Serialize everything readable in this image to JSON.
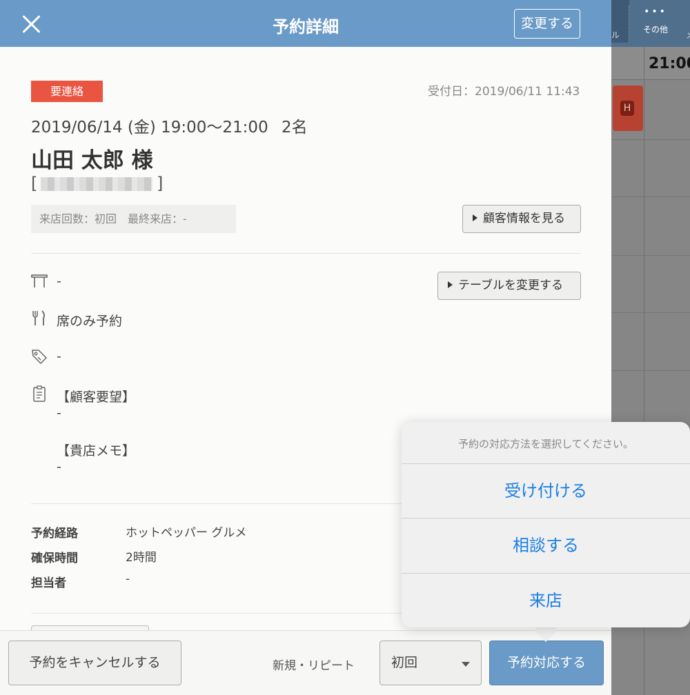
{
  "background": {
    "tab_partial_label": "ル",
    "more_dots": "•••",
    "more_label": "その他",
    "edge_label": "メ",
    "time_header": "21:00",
    "reservation_icon": "H"
  },
  "header": {
    "title": "予約詳細",
    "edit_label": "変更する"
  },
  "reservation": {
    "status_badge": "要連絡",
    "received_at": "受付日：2019/06/11 11:43",
    "datetime": "2019/06/14 (金) 19:00〜21:00",
    "party_size": "2名",
    "customer_name": "山田 太郎 様",
    "phone_open": "[",
    "phone_close": "]",
    "visit_history": "来店回数：初回　最終来店：-",
    "view_customer_label": "顧客情報を見る",
    "table_value": "-",
    "change_table_label": "テーブルを変更する",
    "course_value": "席のみ予約",
    "tag_value": "-",
    "request_heading": "【顧客要望】",
    "request_value": "-",
    "memo_heading": "【貴店メモ】",
    "memo_value": "-"
  },
  "details": [
    {
      "label": "予約経路",
      "value": "ホットペッパー グルメ"
    },
    {
      "label": "確保時間",
      "value": "2時間"
    },
    {
      "label": "担当者",
      "value": "-"
    }
  ],
  "footer": {
    "cancel_label": "予約をキャンセルする",
    "repeat_label": "新規・リピート",
    "visit_type_selected": "初回",
    "respond_label": "予約対応する"
  },
  "popover": {
    "prompt": "予約の対応方法を選択してください。",
    "options": [
      "受け付ける",
      "相談する",
      "来店"
    ]
  },
  "colors": {
    "header_blue": "#6a9ac7",
    "badge_red": "#e95541",
    "action_blue": "#1a7fe6"
  }
}
